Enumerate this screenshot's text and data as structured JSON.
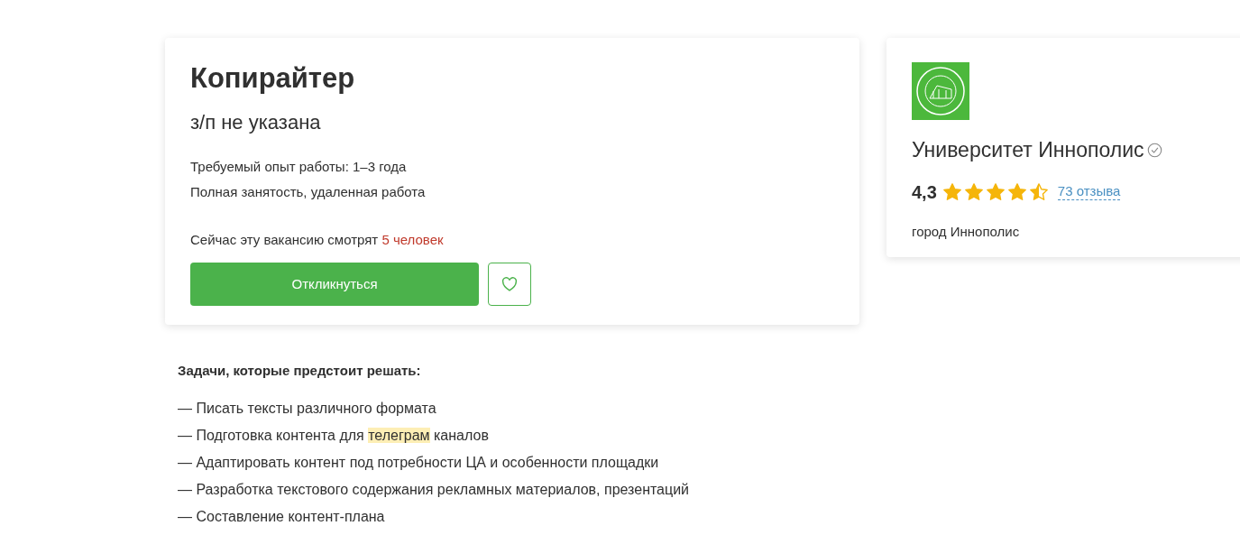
{
  "vacancy": {
    "title": "Копирайтер",
    "salary": "з/п не указана",
    "experience": "Требуемый опыт работы: 1–3 года",
    "employment": "Полная занятость, удаленная работа",
    "viewers": {
      "text": "Сейчас эту вакансию смотрят ",
      "count": "5 человек"
    },
    "apply_button": "Откликнуться"
  },
  "company": {
    "name": "Университет Иннополис",
    "verified": true,
    "rating": "4,3",
    "stars": 4.5,
    "reviews": "73 отзыва",
    "city": "город Иннополис"
  },
  "tasks": {
    "heading": "Задачи, которые предстоит решать:",
    "items": [
      [
        {
          "text": "— Писать тексты различного формата",
          "highlighted": false
        }
      ],
      [
        {
          "text": "— Подготовка контента для ",
          "highlighted": false
        },
        {
          "text": "телеграм",
          "highlighted": true
        },
        {
          "text": " каналов",
          "highlighted": false
        }
      ],
      [
        {
          "text": "— Адаптировать контент под потребности ЦА и особенности площадки",
          "highlighted": false
        }
      ],
      [
        {
          "text": "— Разработка текстового содержания рекламных материалов, презентаций",
          "highlighted": false
        }
      ],
      [
        {
          "text": "— Составление контент-плана",
          "highlighted": false
        }
      ]
    ]
  }
}
